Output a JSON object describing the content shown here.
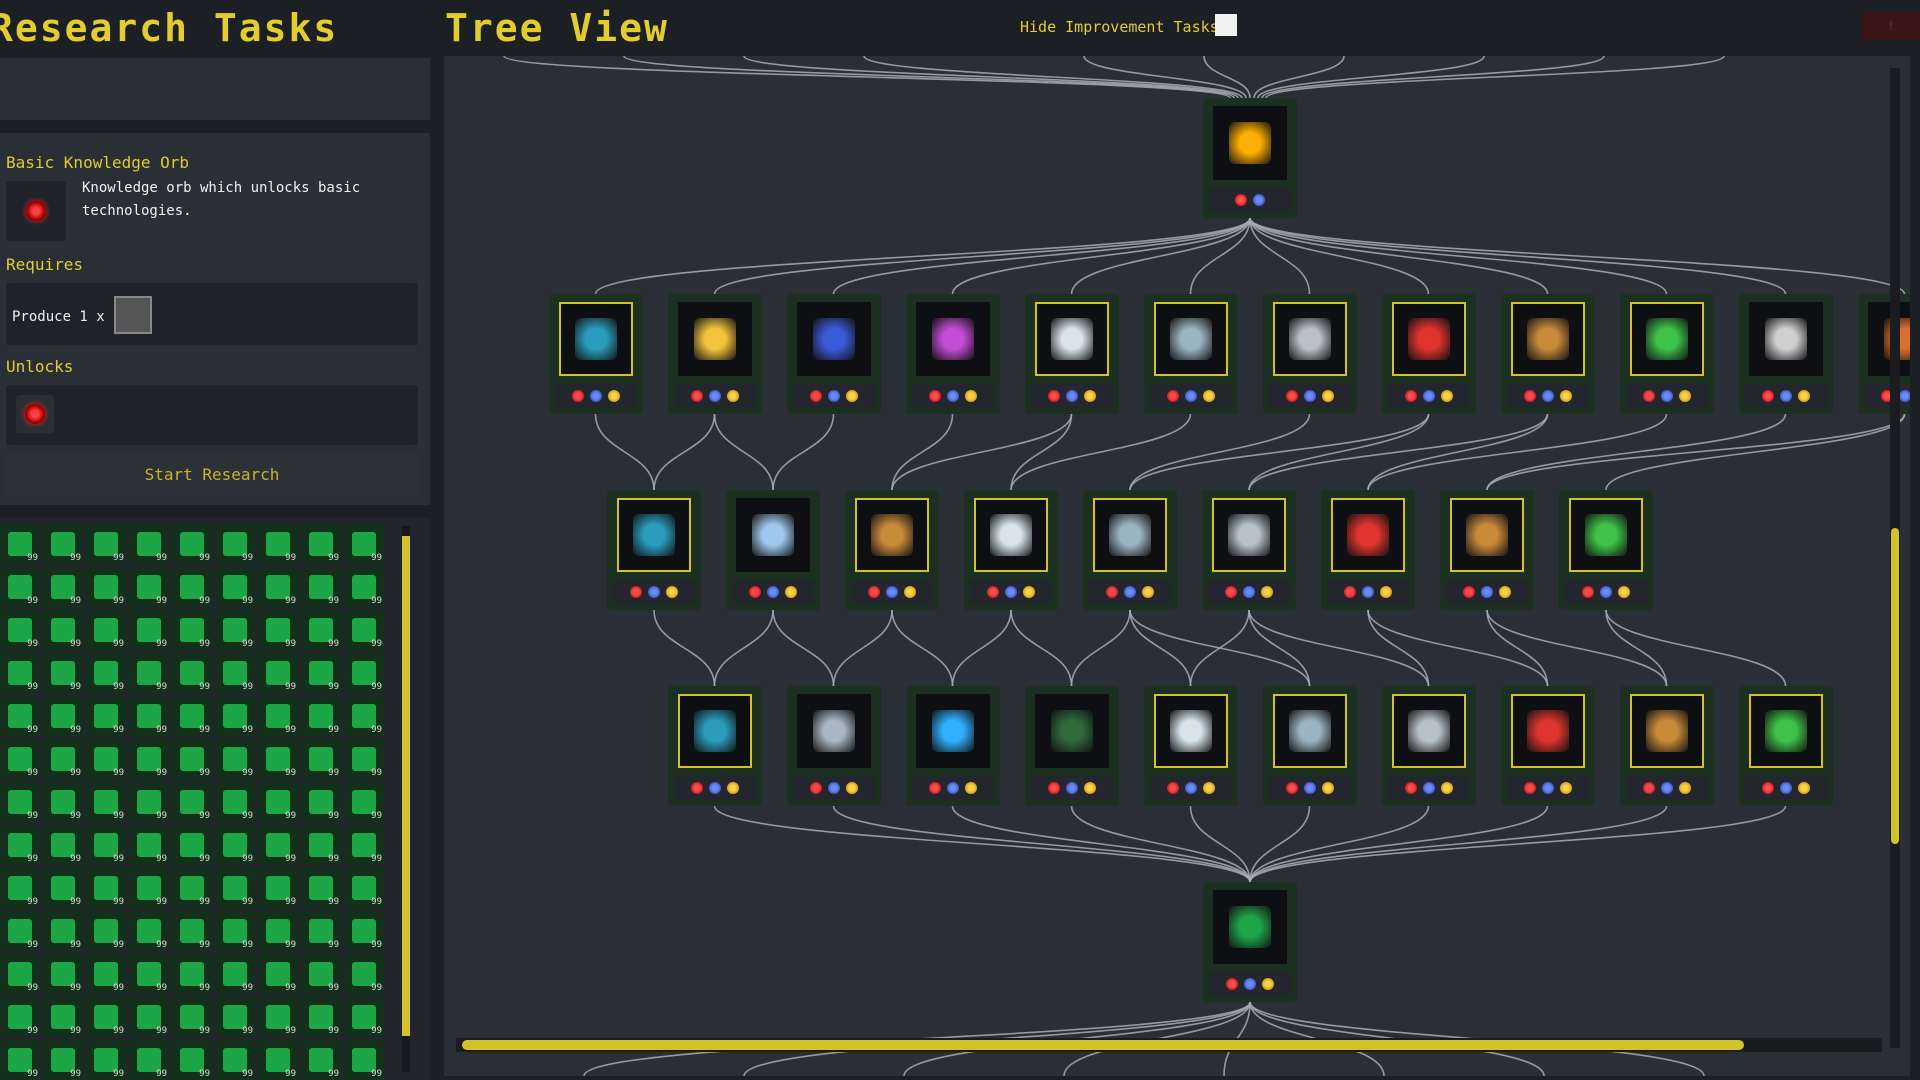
{
  "header": {
    "left_title": "Research Tasks",
    "right_title": "Tree View",
    "hide_label": "Hide Improvement Tasks",
    "corner_label": "!"
  },
  "details": {
    "title": "Basic Knowledge Orb",
    "description": "Knowledge orb which unlocks basic technologies.",
    "requires_label": "Requires",
    "requires_text": "Produce 1 x",
    "unlocks_label": "Unlocks",
    "start_button": "Start Research"
  },
  "inventory": {
    "rows": 13,
    "cols": 9,
    "count_label": "99"
  },
  "tree": {
    "colors": {
      "tier_root": "#ffb000",
      "tier_bottom": "#1ea64a"
    },
    "rows": [
      {
        "nodes": [
          {
            "icon": "golden-sun-orb-icon",
            "dots": [
              "r",
              "b"
            ],
            "color": "#ffb000",
            "plain": true
          }
        ]
      },
      {
        "nodes": [
          {
            "icon": "mesh-grabber-icon",
            "dots": [
              "r",
              "b",
              "y"
            ],
            "color": "#2a9dbf"
          },
          {
            "icon": "golden-hexagon-icon",
            "dots": [
              "r",
              "b",
              "y"
            ],
            "color": "#f2c43b",
            "plain": true
          },
          {
            "icon": "blue-chip-icon",
            "dots": [
              "r",
              "b",
              "y"
            ],
            "color": "#3a5bd9",
            "plain": true
          },
          {
            "icon": "pink-circuit-icon",
            "dots": [
              "r",
              "b",
              "y"
            ],
            "color": "#c44cd6",
            "plain": true
          },
          {
            "icon": "bent-pipe-icon",
            "dots": [
              "r",
              "b",
              "y"
            ],
            "color": "#d8e4ea"
          },
          {
            "icon": "robot-body-icon",
            "dots": [
              "r",
              "b",
              "y"
            ],
            "color": "#9bb4c2"
          },
          {
            "icon": "gear-icon",
            "dots": [
              "r",
              "b",
              "y"
            ],
            "color": "#b8c0c8"
          },
          {
            "icon": "laser-arm-icon",
            "dots": [
              "r",
              "b",
              "y"
            ],
            "color": "#e0342e"
          },
          {
            "icon": "copper-bar-icon",
            "dots": [
              "r",
              "b",
              "y"
            ],
            "color": "#c98a3a"
          },
          {
            "icon": "green-frame-icon",
            "dots": [
              "r",
              "b",
              "y"
            ],
            "color": "#3ec24a"
          },
          {
            "icon": "steel-cube-icon",
            "dots": [
              "r",
              "b",
              "y"
            ],
            "color": "#d0d0d0",
            "plain": true
          },
          {
            "icon": "battery-cell-icon",
            "dots": [
              "r",
              "b",
              "y"
            ],
            "color": "#d87030",
            "plain": true
          }
        ]
      },
      {
        "nodes": [
          {
            "icon": "mesh-grabber-icon",
            "dots": [
              "r",
              "b",
              "y"
            ],
            "color": "#2a9dbf"
          },
          {
            "icon": "vial-rack-icon",
            "dots": [
              "r",
              "b",
              "y"
            ],
            "color": "#9ec8ef",
            "plain": true
          },
          {
            "icon": "copper-bar-icon",
            "dots": [
              "r",
              "b",
              "y"
            ],
            "color": "#c98a3a"
          },
          {
            "icon": "bent-pipe-icon",
            "dots": [
              "r",
              "b",
              "y"
            ],
            "color": "#d8e4ea"
          },
          {
            "icon": "robot-body-icon",
            "dots": [
              "r",
              "b",
              "y"
            ],
            "color": "#9bb4c2"
          },
          {
            "icon": "gear-icon",
            "dots": [
              "r",
              "b",
              "y"
            ],
            "color": "#b8c0c8"
          },
          {
            "icon": "laser-arm-icon",
            "dots": [
              "r",
              "b",
              "y"
            ],
            "color": "#e0342e"
          },
          {
            "icon": "copper-bar-icon",
            "dots": [
              "r",
              "b",
              "y"
            ],
            "color": "#c98a3a"
          },
          {
            "icon": "green-frame-icon",
            "dots": [
              "r",
              "b",
              "y"
            ],
            "color": "#3ec24a"
          }
        ]
      },
      {
        "nodes": [
          {
            "icon": "mesh-grabber-icon",
            "dots": [
              "r",
              "b",
              "y"
            ],
            "color": "#2a9dbf"
          },
          {
            "icon": "steel-cabinet-icon",
            "dots": [
              "r",
              "b",
              "y"
            ],
            "color": "#a9b6c4",
            "plain": true
          },
          {
            "icon": "core-module-icon",
            "dots": [
              "r",
              "b",
              "y"
            ],
            "color": "#30b0ff",
            "plain": true
          },
          {
            "icon": "server-rack-icon",
            "dots": [
              "r",
              "b",
              "y"
            ],
            "color": "#2f6b3c",
            "plain": true
          },
          {
            "icon": "bent-pipe-icon",
            "dots": [
              "r",
              "b",
              "y"
            ],
            "color": "#d8e4ea"
          },
          {
            "icon": "robot-body-icon",
            "dots": [
              "r",
              "b",
              "y"
            ],
            "color": "#9bb4c2"
          },
          {
            "icon": "gear-icon",
            "dots": [
              "r",
              "b",
              "y"
            ],
            "color": "#b8c0c8"
          },
          {
            "icon": "laser-arm-icon",
            "dots": [
              "r",
              "b",
              "y"
            ],
            "color": "#e0342e"
          },
          {
            "icon": "copper-bar-icon",
            "dots": [
              "r",
              "b",
              "y"
            ],
            "color": "#c98a3a"
          },
          {
            "icon": "green-frame-icon",
            "dots": [
              "r",
              "b",
              "y"
            ],
            "color": "#3ec24a"
          }
        ]
      },
      {
        "nodes": [
          {
            "icon": "green-orb-icon",
            "dots": [
              "r",
              "b",
              "y"
            ],
            "color": "#1ea64a",
            "plain": true
          }
        ]
      }
    ]
  }
}
